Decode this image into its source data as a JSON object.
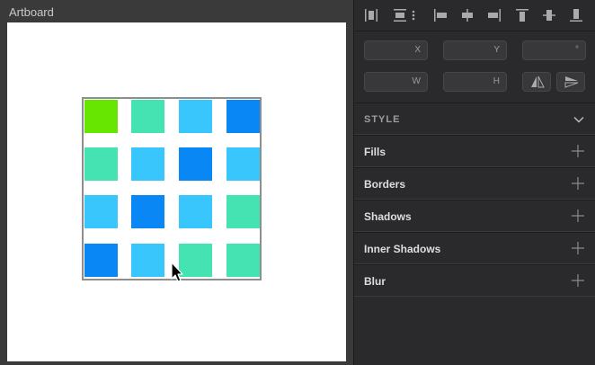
{
  "canvas": {
    "artboard_title": "Artboard",
    "tile_colors": [
      [
        "#66e600",
        "#46e3b2",
        "#38c6fc",
        "#0987f5"
      ],
      [
        "#46e3b2",
        "#38c6fc",
        "#0987f5",
        "#38c6fc"
      ],
      [
        "#38c6fc",
        "#0987f5",
        "#38c6fc",
        "#46e3b2"
      ],
      [
        "#0987f5",
        "#38c6fc",
        "#46e3b2",
        "#46e3b2"
      ]
    ]
  },
  "inspector": {
    "align_tools": [
      "distribute-horizontal-icon",
      "distribute-vertical-icon",
      "more-icon",
      "align-left-icon",
      "align-horizontal-center-icon",
      "align-right-icon",
      "align-top-icon",
      "align-vertical-center-icon",
      "align-bottom-icon"
    ],
    "fields": {
      "x_label": "X",
      "y_label": "Y",
      "rotation_label": "°",
      "w_label": "W",
      "h_label": "H"
    },
    "style_header": "STYLE",
    "sections": [
      "Fills",
      "Borders",
      "Shadows",
      "Inner Shadows",
      "Blur"
    ]
  }
}
